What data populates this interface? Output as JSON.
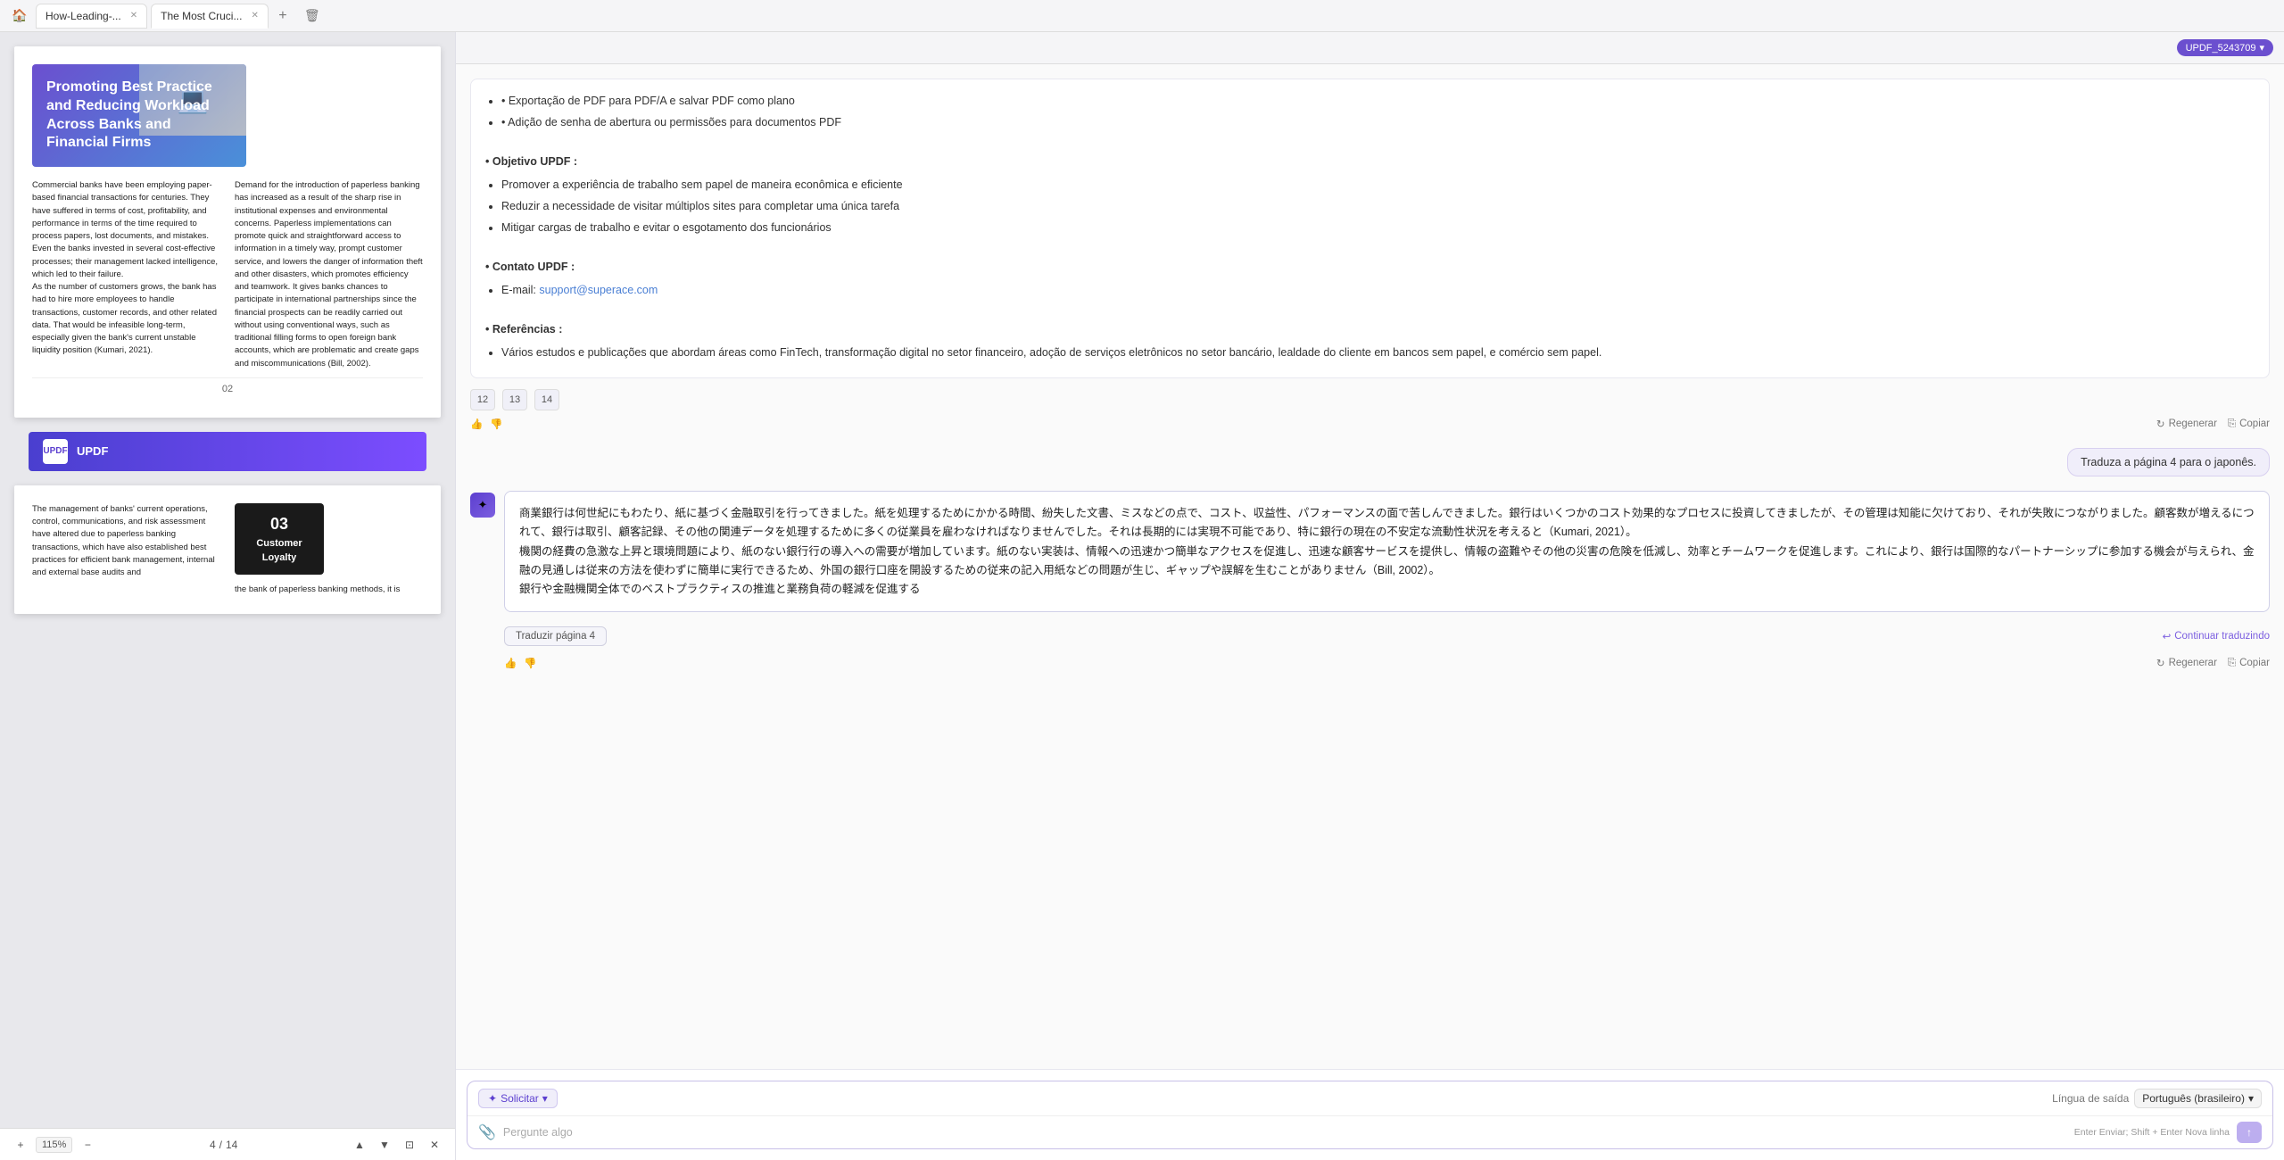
{
  "tabs": [
    {
      "id": "tab1",
      "label": "How-Leading-...",
      "active": false
    },
    {
      "id": "tab2",
      "label": "The Most Cruci...",
      "active": true
    }
  ],
  "pdf": {
    "page2": {
      "hero_title": "Promoting Best Practice and Reducing Workload Across Banks and Financial Firms",
      "col1": "Commercial banks have been employing paper-based financial transactions for centuries. They have suffered in terms of cost, profitability, and performance in terms of the time required to process papers, lost documents, and mistakes. Even the banks invested in several cost-effective processes; their management lacked intelligence, which led to their failure.\nAs the number of customers grows, the bank has had to hire more employees to handle transactions, customer records, and other related data. That would be infeasible long-term, especially given the bank's current unstable liquidity position (Kumari, 2021).",
      "col2": "Demand for the introduction of paperless banking has increased as a result of the sharp rise in institutional expenses and environmental concerns. Paperless implementations can promote quick and straightforward access to information in a timely way, prompt customer service, and lowers the danger of information theft and other disasters, which promotes efficiency and teamwork. It gives banks chances to participate in international partnerships since the financial prospects can be readily carried out without using conventional ways, such as traditional filling forms to open foreign bank accounts, which are problematic and create gaps and miscommunications (Bill, 2002).",
      "page_num": "02"
    },
    "page3": {
      "section_num": "03",
      "section_label": "Customer Loyalty",
      "col1": "The management of banks' current operations, control, communications, and risk assessment have altered due to paperless banking transactions, which have also established best practices for efficient bank management, internal and external base audits and",
      "col2_partial": "the bank of paperless banking methods, it is"
    },
    "current_page": "4",
    "total_pages": "14",
    "zoom": "115%"
  },
  "updf_banner": {
    "logo": "UPDF",
    "text": "UPDF"
  },
  "ai_header": {
    "user_badge": "UPDF_5243709",
    "chevron": "▾"
  },
  "ai_messages": [
    {
      "type": "assistant",
      "content_sections": [
        {
          "label": "• Exportação de PDF para PDF/A e salvar PDF como plano"
        },
        {
          "label": "• Adição de senha de abertura ou permissões para documentos PDF"
        }
      ],
      "objective_label": "• Objetivo UPDF :",
      "objective_items": [
        "Promover a experiência de trabalho sem papel de maneira econômica e eficiente",
        "Reduzir a necessidade de visitar múltiplos sites para completar uma única tarefa",
        "Mitigar cargas de trabalho e evitar o esgotamento dos funcionários"
      ],
      "contact_label": "• Contato UPDF :",
      "contact_email_label": "E-mail:",
      "contact_email": "support@superace.com",
      "references_label": "• Referências :",
      "references_text": "Vários estudos e publicações que abordam áreas como FinTech, transformação digital no setor financeiro, adoção de serviços eletrônicos no setor bancário, lealdade do cliente em bancos sem papel, e comércio sem papel.",
      "pagination": [
        "12",
        "13",
        "14"
      ],
      "action_regenerate": "Regenerar",
      "action_copy": "Copiar"
    },
    {
      "type": "user",
      "text": "Traduza a página 4 para o japonês."
    },
    {
      "type": "assistant_translation",
      "text": "商業銀行は何世紀にもわたり、紙に基づく金融取引を行ってきました。紙を処理するためにかかる時間、紛失した文書、ミスなどの点で、コスト、収益性、パフォーマンスの面で苦しんできました。銀行はいくつかのコスト効果的なプロセスに投資してきましたが、その管理は知能に欠けており、それが失敗につながりました。顧客数が増えるにつれて、銀行は取引、顧客記録、その他の関連データを処理するために多くの従業員を雇わなければなりませんでした。それは長期的には実現不可能であり、特に銀行の現在の不安定な流動性状況を考えると（Kumari, 2021）。\n機関の経費の急激な上昇と環境問題により、紙のない銀行行の導入への需要が増加しています。紙のない実装は、情報への迅速かつ簡単なアクセスを促進し、迅速な顧客サービスを提供し、情報の盗難やその他の災害の危険を低減し、効率とチームワークを促進します。これにより、銀行は国際的なパートナーシップに参加する機会が与えられ、金融の見通しは従来の方法を使わずに簡単に実行できるため、外国の銀行口座を開設するための従来の記入用紙などの問題が生じ、ギャップや誤解を生むことがありません（Bill, 2002）。\n銀行や金融機関全体でのベストプラクティスの推進と業務負荷の軽減を促進する",
      "translate_btn": "Traduzir página 4",
      "continue_label": "Continuar traduzindo",
      "action_regenerate": "Regenerar",
      "action_copy": "Copiar"
    }
  ],
  "ai_input": {
    "solicitar_label": "Solicitar",
    "solicitar_chevron": "▾",
    "lingua_label": "Língua de saída",
    "lingua_value": "Português (brasileiro)",
    "lingua_chevron": "▾",
    "placeholder": "Pergunte algo",
    "send_hint": "Enter Enviar; Shift + Enter Nova linha"
  }
}
